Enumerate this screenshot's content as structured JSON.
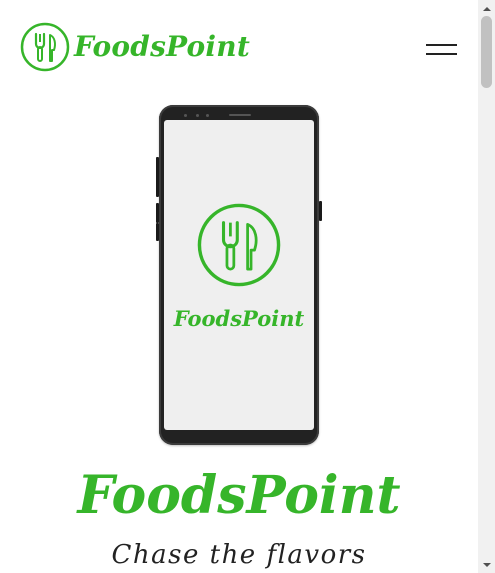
{
  "header": {
    "brand": "FoodsPoint",
    "brand_color": "#36b52a",
    "logo_icon": "fork-knife-circle-icon",
    "menu_icon": "hamburger-menu-icon"
  },
  "phone": {
    "brand": "FoodsPoint",
    "logo_icon": "fork-knife-circle-icon"
  },
  "hero": {
    "title": "FoodsPoint",
    "subtitle": "Chase the flavors"
  },
  "scrollbar": {
    "up_icon": "scroll-up-arrow-icon",
    "down_icon": "scroll-down-arrow-icon"
  }
}
